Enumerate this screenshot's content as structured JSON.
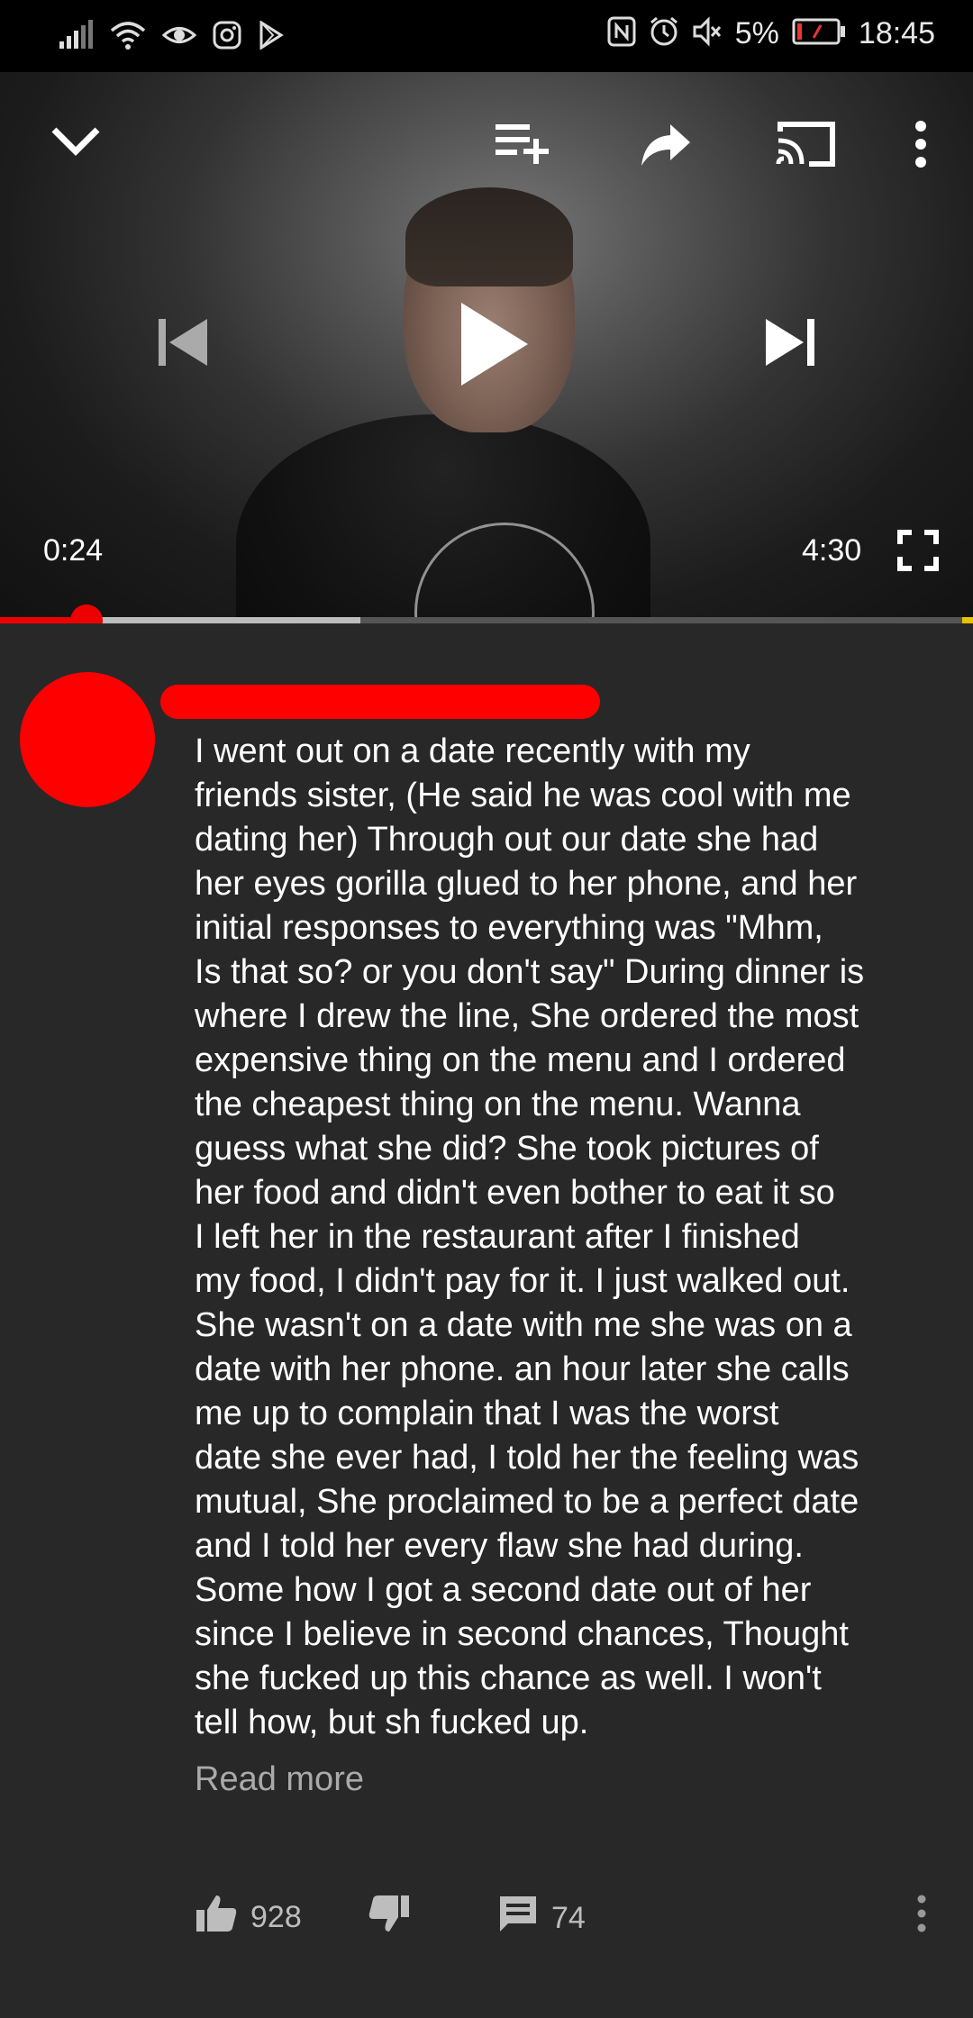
{
  "status_bar": {
    "battery": "5%",
    "time": "18:45"
  },
  "player": {
    "current_time": "0:24",
    "total_time": "4:30",
    "played_fraction": 0.089,
    "buffered_fraction": 0.37,
    "icons": [
      "collapse-icon",
      "add-to-playlist-icon",
      "share-icon",
      "cast-icon",
      "more-vert-icon",
      "previous-icon",
      "play-icon",
      "next-icon",
      "fullscreen-icon"
    ]
  },
  "comment": {
    "text": "I went out on a date recently with my\nfriends sister, (He said he was cool with me\ndating her) Through out our date she had\nher eyes gorilla glued to her phone, and her\ninitial responses to everything was \"Mhm,\nIs that so? or you don't say\" During dinner is\nwhere I drew the line, She ordered the most\nexpensive thing on the menu and I ordered\nthe cheapest thing on the menu. Wanna\nguess what she did? She took pictures of\nher food and didn't even bother to eat it so\nI left her in the restaurant after I finished\nmy food, I didn't pay for it. I just walked out.\nShe wasn't on a date with me she was on a\ndate with her phone. an hour later she calls\nme up to complain that I was the worst\ndate she ever had, I told her the feeling was\nmutual, She proclaimed to be a perfect date\nand I told her every flaw she had during.\nSome how I got a second date out of her\nsince I believe in second chances, Thought\nshe fucked up this chance as well. I won't\ntell how, but sh fucked up.",
    "read_more": "Read more",
    "likes": "928",
    "replies": "74"
  }
}
